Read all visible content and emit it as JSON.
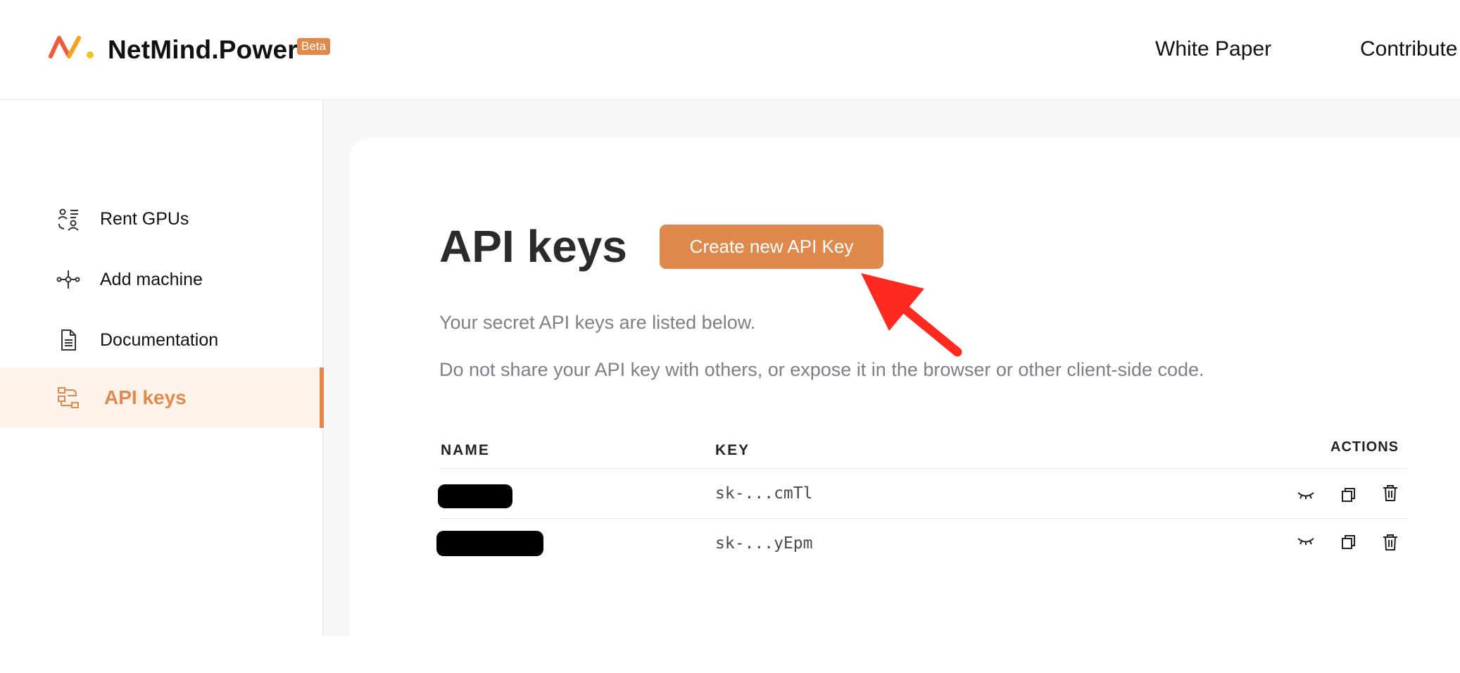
{
  "header": {
    "brand": "NetMind.Power",
    "badge": "Beta",
    "nav": [
      "White Paper",
      "Contribute"
    ]
  },
  "sidebar": {
    "items": [
      {
        "label": "Rent GPUs",
        "icon": "rent-gpus-icon"
      },
      {
        "label": "Add machine",
        "icon": "add-machine-icon"
      },
      {
        "label": "Documentation",
        "icon": "document-icon"
      },
      {
        "label": "API keys",
        "icon": "api-keys-icon",
        "active": true
      }
    ]
  },
  "main": {
    "title": "API keys",
    "create_button": "Create new API Key",
    "description_1": "Your secret API keys are listed below.",
    "description_2": "Do not share your API key with others, or expose it in the browser or other client-side code.",
    "table": {
      "headers": {
        "name": "NAME",
        "key": "KEY",
        "actions": "ACTIONS"
      },
      "rows": [
        {
          "name": "[redacted]",
          "key": "sk-...cmTl"
        },
        {
          "name": "[redacted]",
          "key": "sk-...yEpm"
        }
      ],
      "action_icons": [
        "eye-closed-icon",
        "copy-icon",
        "trash-icon"
      ]
    }
  },
  "colors": {
    "accent": "#e0894c",
    "active_bg": "#fdf3ea",
    "annotation_arrow": "#ff2a1f"
  }
}
